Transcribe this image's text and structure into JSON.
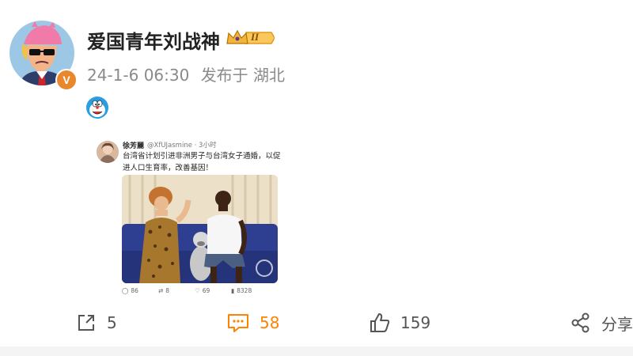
{
  "post": {
    "username": "爱国青年刘战神",
    "level": "II",
    "verified_mark": "V",
    "date": "24-1-6 06:30",
    "location": "发布于 湖北",
    "emoji_icon": "doraemon-emoji-icon"
  },
  "embedded_tweet": {
    "name": "徐芳麗",
    "handle": "@XfUJasmine · 3小时",
    "text": "台湾省计划引进非洲男子与台湾女子通婚，以促进人口生育率，改善基因！",
    "stats": {
      "replies": "86",
      "retweets": "8",
      "likes": "69",
      "views": "8328"
    }
  },
  "actions": {
    "share_count": "5",
    "comment_count": "58",
    "like_count": "159",
    "forward_label": "分享"
  },
  "colors": {
    "accent": "#ff8200",
    "meta_text": "#8a8a8a",
    "verified": "#e8872b",
    "avatar_bg": "#9cc8e6"
  }
}
